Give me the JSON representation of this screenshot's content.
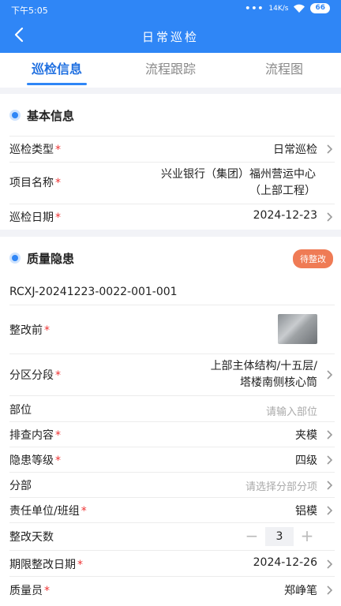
{
  "status_bar": {
    "time": "下午5:05",
    "dots": "•••",
    "net": "14K/s",
    "battery": "66"
  },
  "nav": {
    "title": "日常巡检"
  },
  "tabs": [
    {
      "label": "巡检信息"
    },
    {
      "label": "流程跟踪"
    },
    {
      "label": "流程图"
    }
  ],
  "basic": {
    "title": "基本信息",
    "type": {
      "label": "巡检类型",
      "value": "日常巡检"
    },
    "project": {
      "label": "项目名称",
      "value_line1": "兴业银行（集团）福州营运中心",
      "value_line2": "（上部工程）"
    },
    "date": {
      "label": "巡检日期",
      "value": "2024-12-23"
    }
  },
  "quality": {
    "title": "质量隐患",
    "badge": "待整改",
    "code": "RCXJ-20241223-0022-001-001",
    "before": {
      "label": "整改前"
    },
    "zone": {
      "label": "分区分段",
      "value_line1": "上部主体结构/十五层/",
      "value_line2": "塔楼南侧核心筒"
    },
    "part": {
      "label": "部位",
      "placeholder": "请输入部位"
    },
    "content": {
      "label": "排查内容",
      "value": "夹模"
    },
    "level": {
      "label": "隐患等级",
      "value": "四级"
    },
    "division": {
      "label": "分部",
      "placeholder": "请选择分部分项"
    },
    "unit": {
      "label": "责任单位/班组",
      "value": "铝模"
    },
    "days": {
      "label": "整改天数",
      "value": "3",
      "minus": "−",
      "plus": "+"
    },
    "deadline": {
      "label": "期限整改日期",
      "value": "2024-12-26"
    },
    "inspector": {
      "label": "质量员",
      "value": "郑峥笔"
    }
  },
  "required_mark": "*",
  "colors": {
    "primary": "#2f86f6",
    "badge": "#ef7b55",
    "required": "#e33333"
  }
}
